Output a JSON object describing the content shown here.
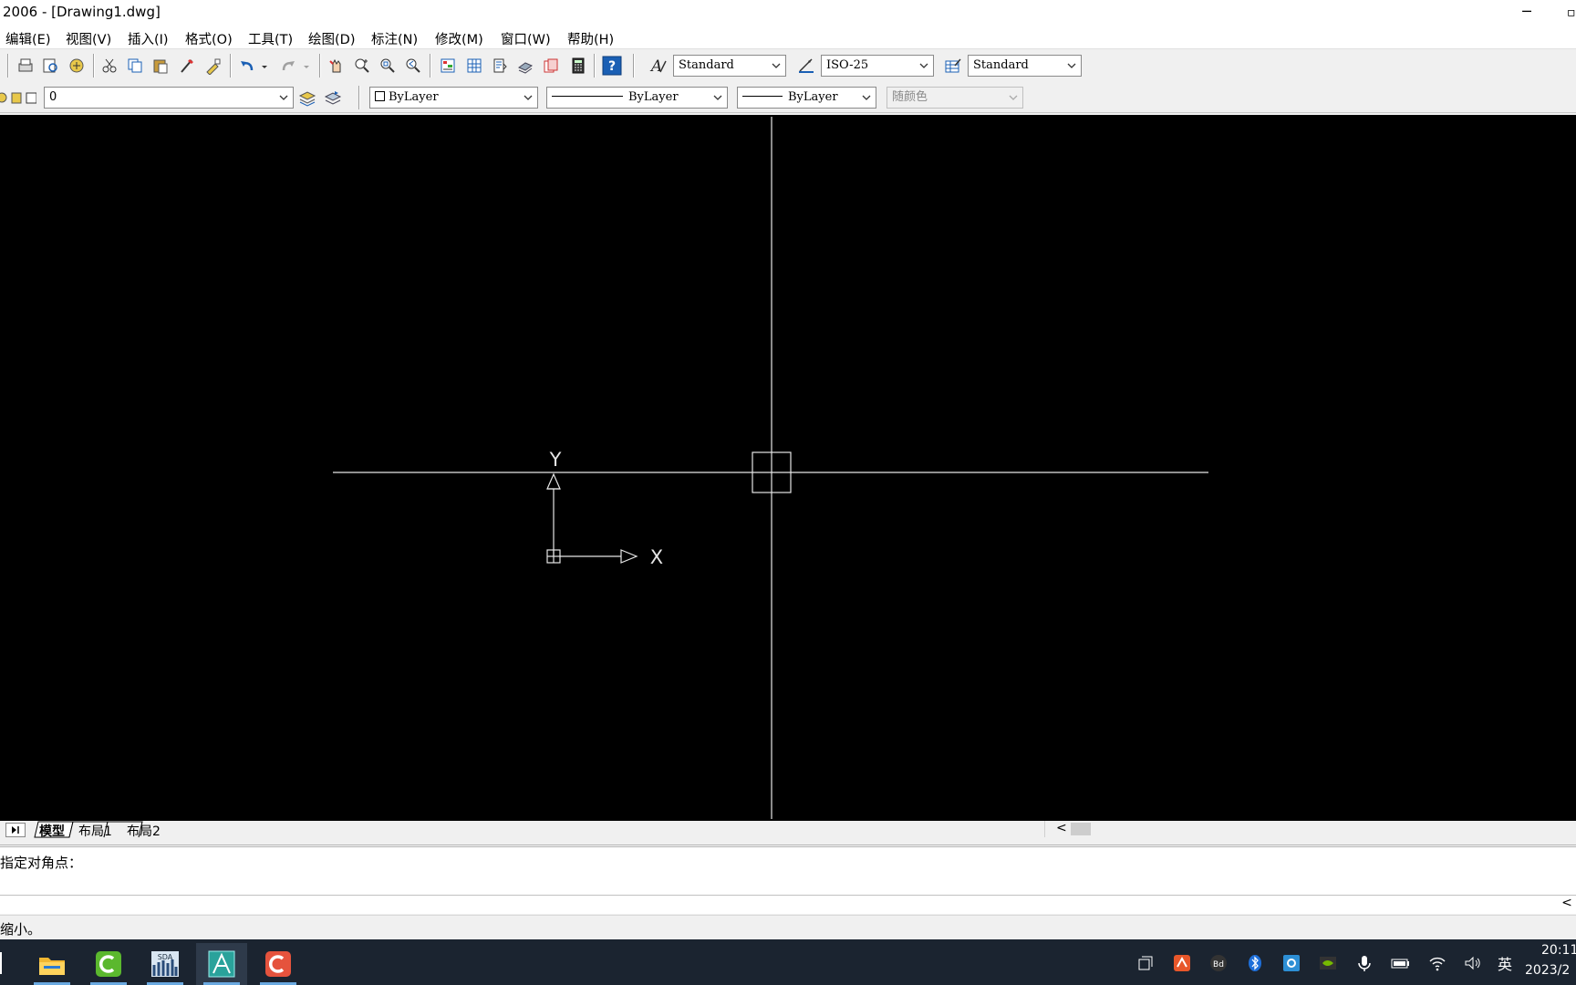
{
  "window": {
    "title": "2006 - [Drawing1.dwg]",
    "minimize_glyph": "─",
    "maximize_glyph": "▫"
  },
  "menu": {
    "items": [
      {
        "label": "编辑(E)"
      },
      {
        "label": "视图(V)"
      },
      {
        "label": "插入(I)"
      },
      {
        "label": "格式(O)"
      },
      {
        "label": "工具(T)"
      },
      {
        "label": "绘图(D)"
      },
      {
        "label": "标注(N)"
      },
      {
        "label": "修改(M)"
      },
      {
        "label": "窗口(W)"
      },
      {
        "label": "帮助(H)"
      }
    ]
  },
  "toolbar_standard": {
    "text_style": "Standard",
    "dim_style": "ISO-25",
    "table_style": "Standard"
  },
  "toolbar_properties": {
    "layer": "0",
    "color": "ByLayer",
    "linetype": "ByLayer",
    "lineweight": "ByLayer",
    "plotstyle": "随颜色"
  },
  "canvas": {
    "background": "#000000",
    "ucs_x_label": "X",
    "ucs_y_label": "Y"
  },
  "layout_tabs": [
    "模型",
    "布局1",
    "布局2"
  ],
  "command": {
    "history_line": "指定对角点：",
    "scroll_glyph": "<"
  },
  "status": {
    "message": "缩小。"
  },
  "hscroll": {
    "left_glyph": "<"
  },
  "taskbar": {
    "apps": [
      "file-explorer",
      "camtasia",
      "sda-app",
      "autocad",
      "camtasia-recorder"
    ],
    "active_app": "autocad",
    "input_method": "英",
    "time": "20:11",
    "date": "2023/2"
  }
}
